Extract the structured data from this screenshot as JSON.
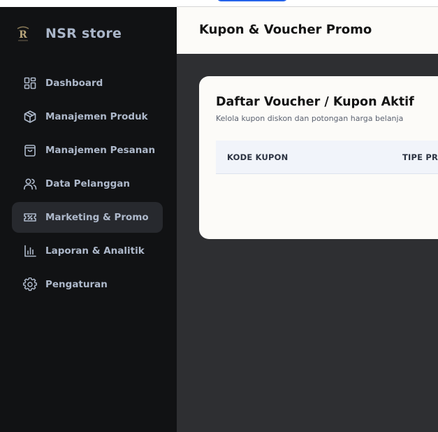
{
  "brand": {
    "name": "NSR store",
    "logo_text": "R"
  },
  "sidebar": {
    "items": [
      {
        "label": "Dashboard",
        "icon": "dashboard-icon",
        "active": false
      },
      {
        "label": "Manajemen Produk",
        "icon": "box-icon",
        "active": false
      },
      {
        "label": "Manajemen Pesanan",
        "icon": "shopping-bag-icon",
        "active": false
      },
      {
        "label": "Data Pelanggan",
        "icon": "users-icon",
        "active": false
      },
      {
        "label": "Marketing & Promo",
        "icon": "ticket-icon",
        "active": true
      },
      {
        "label": "Laporan & Analitik",
        "icon": "bar-chart-icon",
        "active": false
      },
      {
        "label": "Pengaturan",
        "icon": "gear-icon",
        "active": false
      }
    ]
  },
  "header": {
    "title": "Kupon & Voucher Promo"
  },
  "card": {
    "title": "Daftar Voucher / Kupon Aktif",
    "subtitle": "Kelola kupon diskon dan potongan harga belanja",
    "columns": [
      "KODE KUPON",
      "TIPE PRO"
    ]
  },
  "colors": {
    "sidebar_bg": "#111214",
    "active_item_bg": "#27292e",
    "content_bg": "#2e2f32",
    "card_bg": "#fcfbf8",
    "accent": "#2563eb"
  }
}
